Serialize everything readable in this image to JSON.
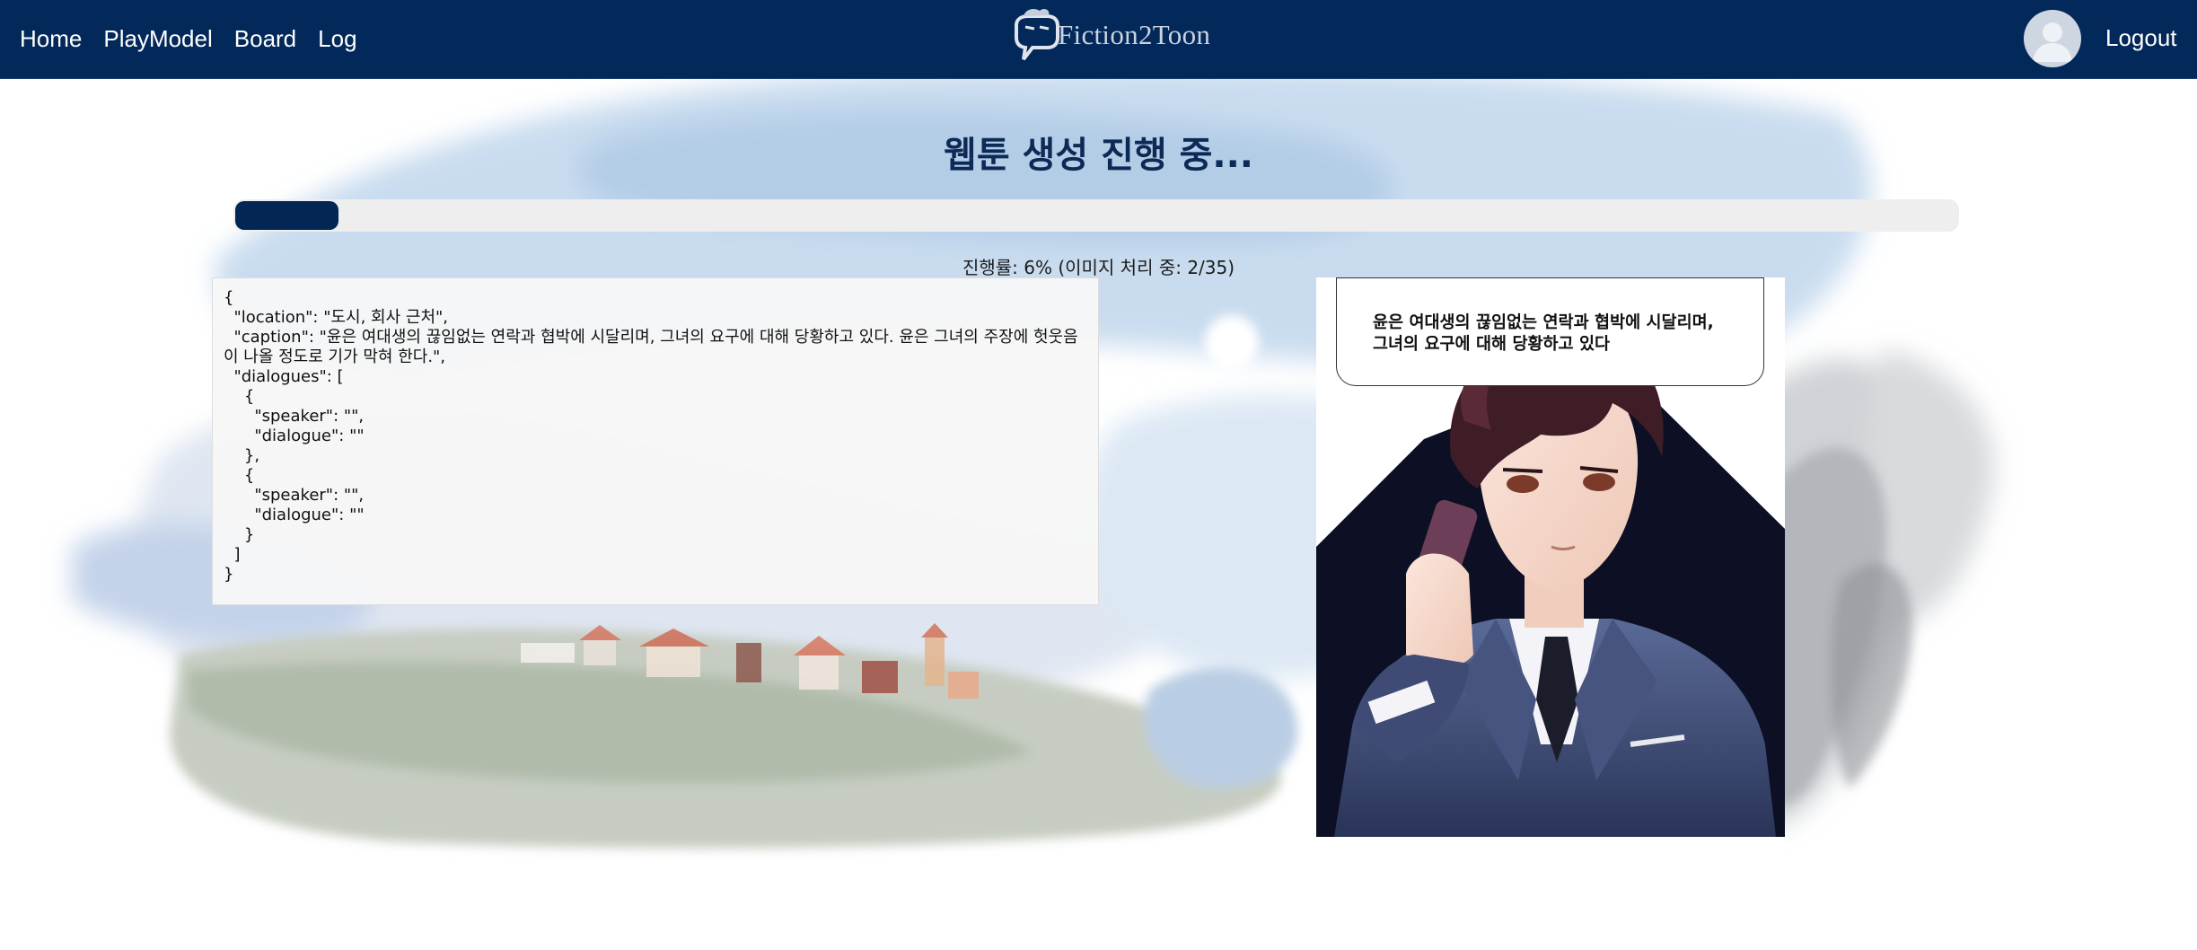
{
  "nav": {
    "links": [
      "Home",
      "PlayModel",
      "Board",
      "Log"
    ],
    "brand": "Fiction2Toon",
    "logout": "Logout"
  },
  "main": {
    "title": "웹툰 생성 진행 중...",
    "progress_percent": 6,
    "status_text": "진행률: 6% (이미지 처리 중: 2/35)",
    "json_text": "{\n  \"location\": \"도시, 회사 근처\",\n  \"caption\": \"윤은 여대생의 끊임없는 연락과 협박에 시달리며, 그녀의 요구에 대해 당황하고 있다. 윤은 그녀의 주장에 헛웃음이 나올 정도로 기가 막혀 한다.\",\n  \"dialogues\": [\n    {\n      \"speaker\": \"\",\n      \"dialogue\": \"\"\n    },\n    {\n      \"speaker\": \"\",\n      \"dialogue\": \"\"\n    }\n  ]\n}",
    "panel_caption_line1": "윤은 여대생의 끊임없는 연락과 협박에 시달리며,",
    "panel_caption_line2": "그녀의 요구에 대해 당황하고 있다"
  },
  "colors": {
    "nav_bg": "#03285a",
    "accent": "#032654",
    "title": "#0c2a56"
  }
}
